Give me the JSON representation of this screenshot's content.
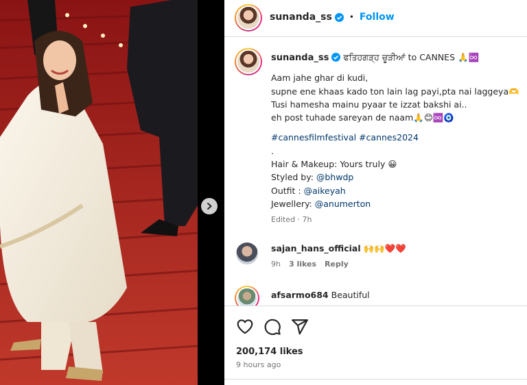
{
  "post": {
    "username": "sunanda_ss",
    "follow_label": "Follow",
    "separator": "•",
    "caption_title": "ਫਤਿਹਗੜ੍ਹ ਚੂੜੀਆਂ to CANNES 🙏♾️",
    "caption_lines": [
      "Aam jahe ghar di kudi,",
      "supne ene khaas kado ton lain lag payi,pta nai laggeya🫶",
      "Tusi hamesha mainu pyaar te izzat bakshi ai..",
      "eh post tuhade sareyan de naam🙏😊♾️🧿"
    ],
    "hashtags": "#cannesfilmfestival #cannes2024",
    "dot_line": ".",
    "credits": {
      "hair_makeup": "Hair & Makeup: Yours truly 😀",
      "styled_label": "Styled by: ",
      "styled_handle": "@bhwdp",
      "outfit_label": "Outfit : ",
      "outfit_handle": "@aikeyah",
      "jewellery_label": "Jewellery: ",
      "jewellery_handle": "@anumerton"
    },
    "edited": "Edited · 7h"
  },
  "comments": [
    {
      "username": "sajan_hans_official",
      "text": "🙌🙌❤️❤️",
      "age": "9h",
      "likes": "3 likes",
      "reply": "Reply"
    },
    {
      "username": "afsarmo684",
      "text": "Beautiful",
      "age": "",
      "likes": "",
      "reply": ""
    }
  ],
  "footer": {
    "likes": "200,174 likes",
    "time": "9 hours ago"
  },
  "icons": {
    "next": "chevron-right-icon",
    "like": "heart-icon",
    "comment": "comment-icon",
    "share": "send-icon",
    "verified": "verified-badge-icon"
  },
  "colors": {
    "link": "#0095f6",
    "hashtag": "#00376b",
    "muted": "#737373",
    "verified": "#0095f6",
    "carpet": "#b71c1c"
  }
}
